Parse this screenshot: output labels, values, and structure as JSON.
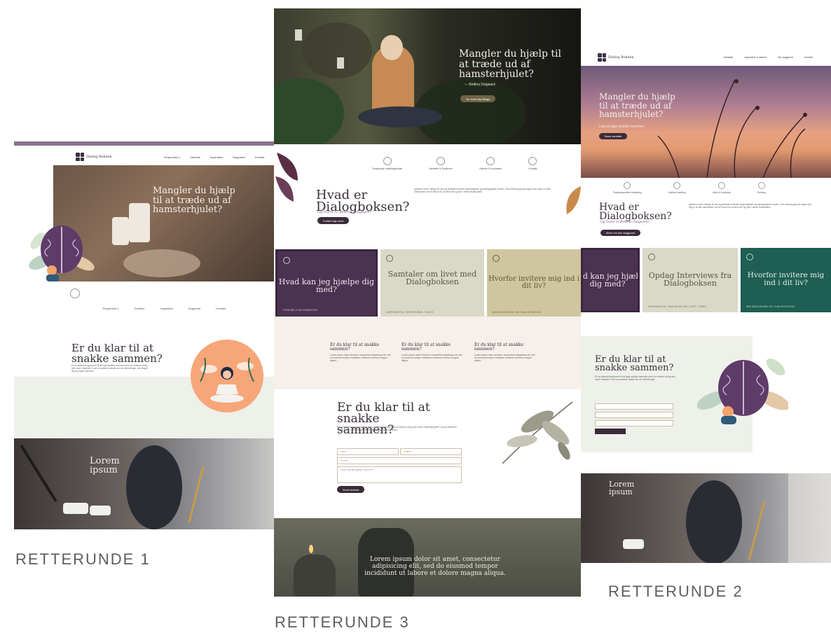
{
  "captions": {
    "r1": "RETTERUNDE 1",
    "r2": "RETTERUNDE 2",
    "r3": "RETTERUNDE 3"
  },
  "colors": {
    "plum": "#3b2b3a",
    "mauve": "#8d7291",
    "purple_card": "#4a3250",
    "sage_card": "#dad8c6",
    "khaki_card": "#cfc59e",
    "teal_card": "#1f5e52",
    "peach": "#f7a679"
  },
  "mockup1": {
    "logo_text": "Dialog Boksen",
    "nav": [
      "Terapeutisk 1",
      "Samtale",
      "Inspiration",
      "Bogpræst",
      "Kontakt"
    ],
    "hero_title": "Mangler du hjælp til at træde ud af hamsterhjulet?",
    "subnav": [
      "Terapeutisk 1",
      "Samtale",
      "Inspiration",
      "Bogpræst",
      "Kontakt"
    ],
    "cta_title": "Er du klar til at snakke sammen?",
    "cta_body": "Er du klarest begynnerer til at tage skridtet sammen med en version af dig selv med i hamster? Lad os sammen skabe om de udfordringer, der lenger dig og bryde sammen.",
    "photo_title": "Lorem ipsum"
  },
  "mockup3": {
    "hero_title": "Mangler du hjælp til at træde ud af hamsterhjulet?",
    "hero_author": "— Bettina Dalgaard",
    "hero_button": "Ja, book dig tilbage",
    "icons": [
      "Terapeutisk udviklingsforløb",
      "Samtaler & Sessioner",
      "Videoer & Inspiration",
      "Kontakt"
    ],
    "intro_title": "Hvad er Dialogboksen?",
    "intro_sub": "Og hvem er Bettina Dalgaard?",
    "intro_button": "Fortæl mig mere",
    "intro_body": "Igennem mine mange år har jeg arbejdet indenfor psykologiske og pædagogiske verden. Den erfaring jeg har taget med mig er at alle mennesker har et behov for at blive set og hørt i deres livssituation.",
    "cards": [
      {
        "title": "Hvad kan jeg hjælpe dig med?",
        "label": "FORLØB & INFORMATION"
      },
      {
        "title": "Samtaler om livet med Dialogboksen",
        "label": "INSPIRATION, INTERVIEWS, VIDEO"
      },
      {
        "title": "Hvorfor invitere mig ind i dit liv?",
        "label": "MIN BAGGRUND OG KVALIFIKATION"
      }
    ],
    "quotes": [
      "Er du klar til at snakke sammen?",
      "Er du klar til at snakke sammen?",
      "Er du klar til at snakke sammen?"
    ],
    "quote_body": "Lorem ipsum dolor sit amet, consectetur adipiscing elit, sed do eiusmod tempor incididunt ut labore et dolore magna aliqua.",
    "form_title": "Er du klar til at snakke sammen?",
    "form_body": "Er du klarest begynnerer til at tage skridtet sammen med en version af dig selv med i hamsterhjulet? Lad os sammen skabe om de udfordringer der lenger dig og bryde sammen.",
    "form": {
      "name_placeholder": "Navn",
      "phone_placeholder": "Telefon",
      "email_placeholder": "E-mail",
      "message_placeholder": "Hvad kan jeg hjælpe dig med?",
      "submit": "Send besked"
    },
    "bottom_quote": "Lorem ipsum dolor sit amet, consectetur adipisicing elit, sed do eiusmod tempor incididunt ut labore et dolore magna aliqua."
  },
  "mockup2": {
    "logo_text": "Dialog Boksen",
    "nav": [
      "Samtaler",
      "Inspiration & videoer",
      "Min baggrund",
      "Kontakt"
    ],
    "hero_title": "Mangler du hjælp til at træde ud af hamsterhjulet?",
    "hero_sub": "Lad os tage skridtet sammen",
    "hero_button": "Book samtale",
    "icons": [
      "Psykoterapeutisk behandling",
      "Spirituel udvikling",
      "Video & Inspiration",
      "Booking"
    ],
    "intro_title": "Hvad er Dialogboksen?",
    "intro_sub": "Og hvem er Bettina Dalgaard?",
    "intro_button": "Mere om min baggrund",
    "cards": [
      {
        "title": "Hvad kan jeg hjælpe dig med?",
        "label": ""
      },
      {
        "title": "Opdag Interviews fra Dialogboksen",
        "label": "INSPIRATION, SAMTALER OM LIVET, VIDEO"
      },
      {
        "title": "Hvorfor invitere mig ind i dit liv?",
        "label": "MIN BAGGRUND OG KVALIFIKATION"
      }
    ],
    "cta_title": "Er du klar til at snakke sammen?",
    "cta_body": "Er du klarest begynnerer til at tage skridtet sammen med en version af dig selv med i hamster? Lad os sammen skabe om de udfordringer.",
    "photo_title": "Lorem ipsum"
  }
}
